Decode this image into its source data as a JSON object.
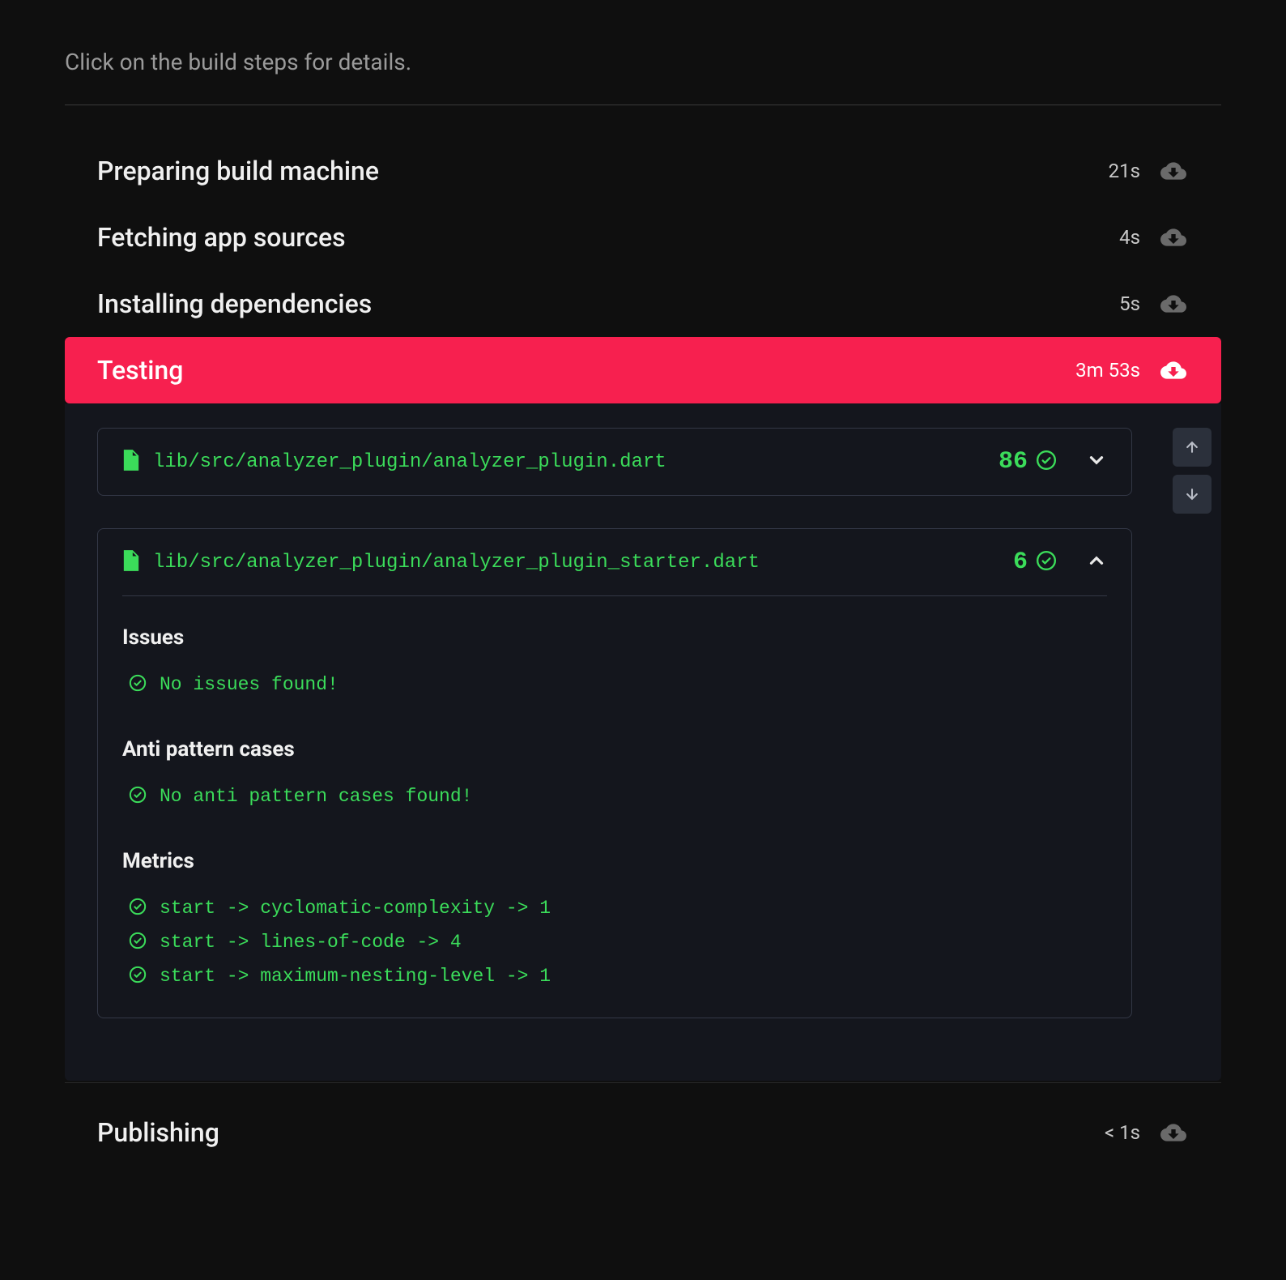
{
  "instruction": "Click on the build steps for details.",
  "steps": [
    {
      "title": "Preparing build machine",
      "time": "21s"
    },
    {
      "title": "Fetching app sources",
      "time": "4s"
    },
    {
      "title": "Installing dependencies",
      "time": "5s"
    }
  ],
  "testing": {
    "title": "Testing",
    "time": "3m 53s",
    "files": [
      {
        "path": "lib/src/analyzer_plugin/analyzer_plugin.dart",
        "count": "86",
        "expanded": false
      },
      {
        "path": "lib/src/analyzer_plugin/analyzer_plugin_starter.dart",
        "count": "6",
        "expanded": true,
        "sections": {
          "issues": {
            "heading": "Issues",
            "lines": [
              "No issues found!"
            ]
          },
          "anti": {
            "heading": "Anti pattern cases",
            "lines": [
              "No anti pattern cases found!"
            ]
          },
          "metrics": {
            "heading": "Metrics",
            "lines": [
              "start -> cyclomatic-complexity -> 1",
              "start -> lines-of-code -> 4",
              "start -> maximum-nesting-level -> 1"
            ]
          }
        }
      }
    ]
  },
  "publishing": {
    "title": "Publishing",
    "time": "< 1s"
  }
}
